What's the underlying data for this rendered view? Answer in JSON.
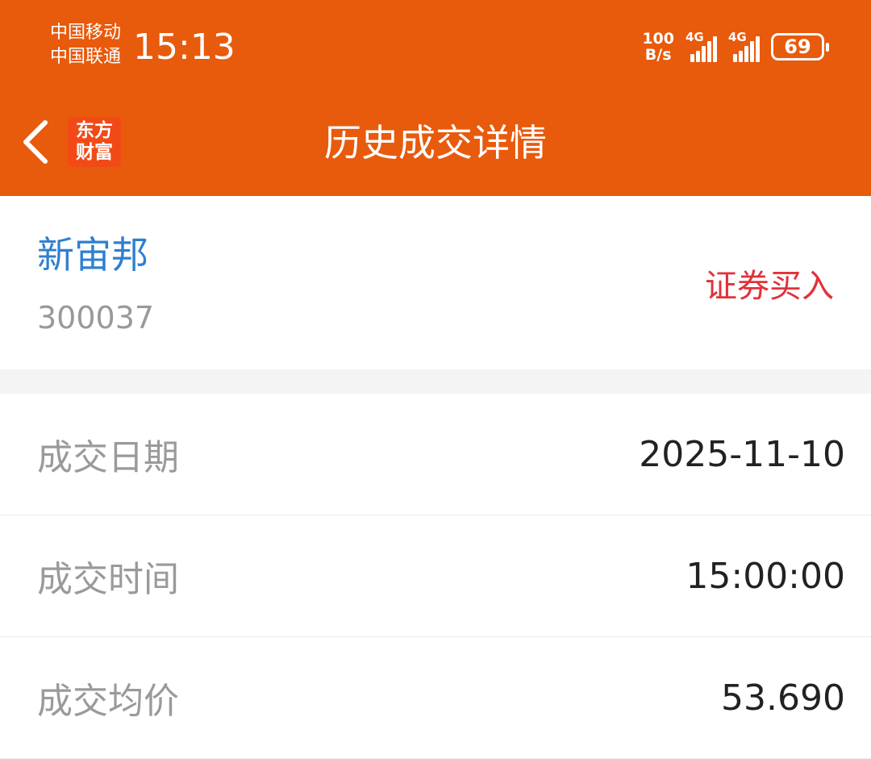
{
  "status_bar": {
    "carrier_1": "中国移动",
    "carrier_2": "中国联通",
    "time": "15:13",
    "net_speed_value": "100",
    "net_speed_unit": "B/s",
    "signal_1_label": "4G",
    "signal_2_label": "4G",
    "battery": "69"
  },
  "nav": {
    "back_icon": "chevron-left-icon",
    "logo_line_1": "东方",
    "logo_line_2": "财富",
    "title": "历史成交详情"
  },
  "stock": {
    "name": "新宙邦",
    "code": "300037",
    "trade_type": "证券买入"
  },
  "details": {
    "rows": [
      {
        "label": "成交日期",
        "value": "2025-11-10"
      },
      {
        "label": "成交时间",
        "value": "15:00:00"
      },
      {
        "label": "成交均价",
        "value": "53.690"
      }
    ]
  },
  "colors": {
    "header_bg": "#e85a0c",
    "stock_name": "#2f7fd0",
    "trade_type": "#e0323a"
  }
}
